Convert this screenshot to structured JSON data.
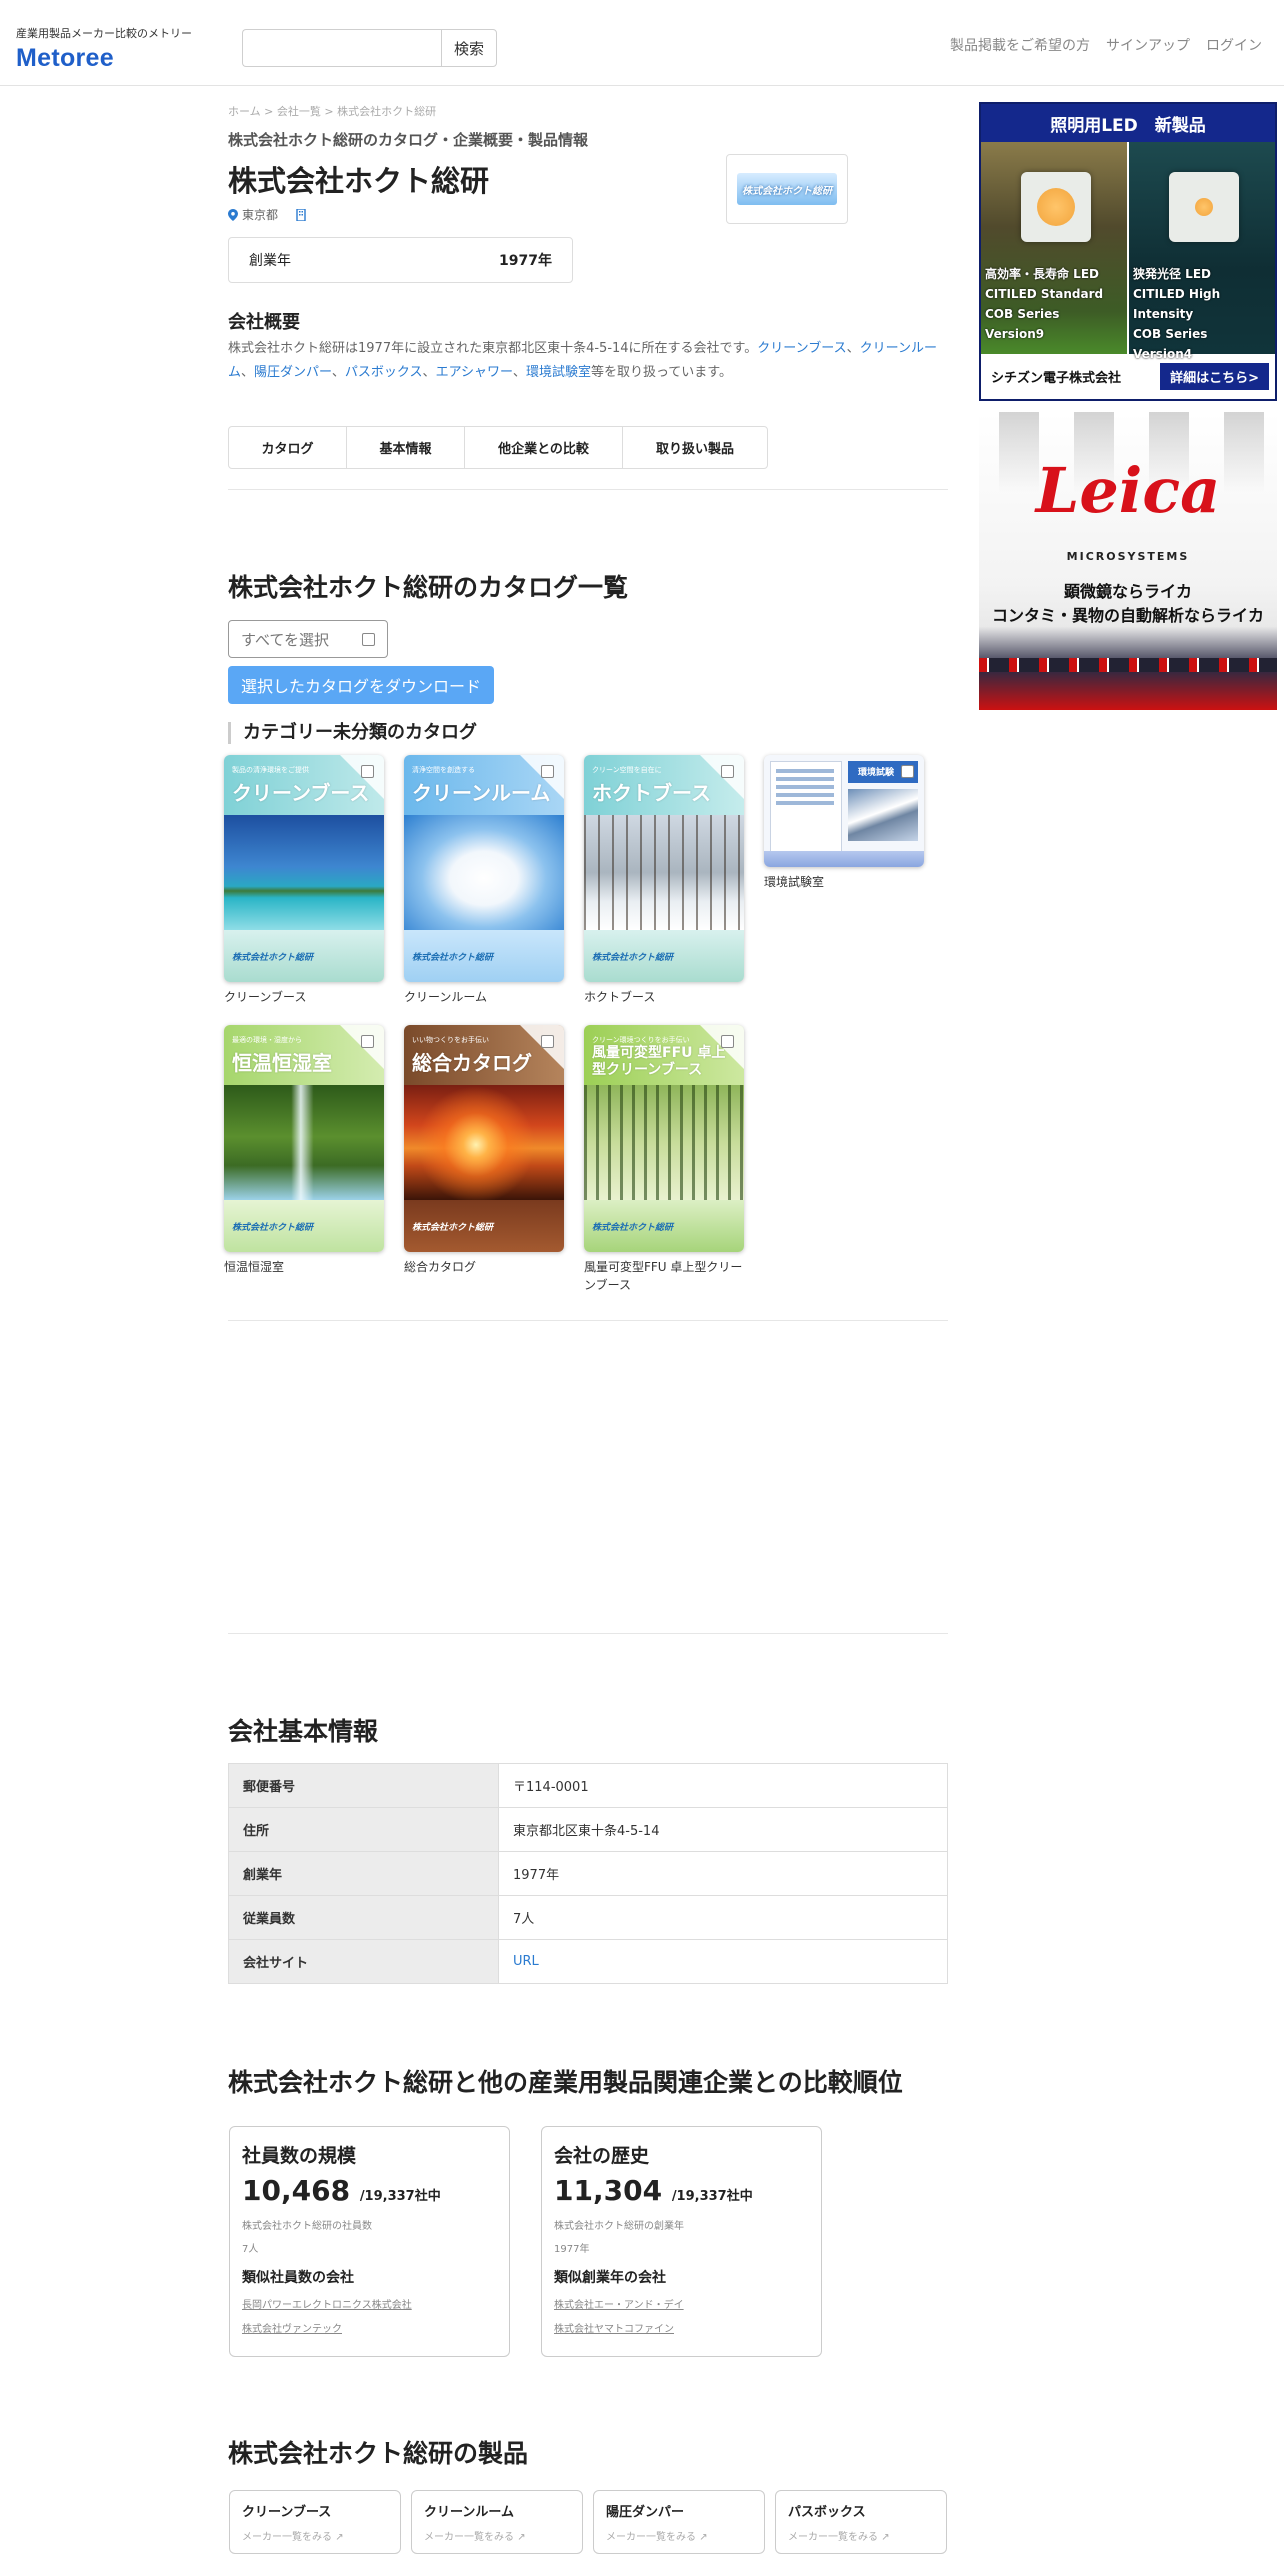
{
  "header": {
    "tagline": "産業用製品メーカー比較のメトリー",
    "logo": "Metoree",
    "search_placeholder": "",
    "search_button": "検索",
    "nav": [
      "製品掲載をご希望の方",
      "サインアップ",
      "ログイン"
    ]
  },
  "breadcrumb": [
    "ホーム",
    "会社一覧",
    "株式会社ホクト総研"
  ],
  "page": {
    "subtitle": "株式会社ホクト総研のカタログ・企業概要・製品情報",
    "company_name": "株式会社ホクト総研",
    "location": "東京都",
    "logo_text": "株式会社ホクト総研",
    "founded_label": "創業年",
    "founded_value": "1977年"
  },
  "overview": {
    "heading": "会社概要",
    "text_prefix": "株式会社ホクト総研は1977年に設立された東京都北区東十条4-5-14に所在する会社です。",
    "links": [
      "クリーンブース",
      "クリーンルーム",
      "陽圧ダンパー",
      "パスボックス",
      "エアシャワー",
      "環境試験室"
    ],
    "text_suffix": "等を取り扱っています。"
  },
  "tabs": [
    "カタログ",
    "基本情報",
    "他企業との比較",
    "取り扱い製品"
  ],
  "catalog": {
    "heading": "株式会社ホクト総研のカタログ一覧",
    "select_all": "すべてを選択",
    "download_button": "選択したカタログをダウンロード",
    "category_heading": "カテゴリー未分類のカタログ",
    "items": [
      {
        "label": "クリーンブース",
        "cover_title": "クリーンブース",
        "cover_small": "製品の清浄環境をご提供"
      },
      {
        "label": "クリーンルーム",
        "cover_title": "クリーンルーム",
        "cover_small": "清浄空間を創造する"
      },
      {
        "label": "ホクトブース",
        "cover_title": "ホクトブース",
        "cover_small": "クリーン空間を自在に"
      },
      {
        "label": "環境試験室",
        "cover_title": "環境試験",
        "cover_small": ""
      },
      {
        "label": "恒温恒湿室",
        "cover_title": "恒温恒湿室",
        "cover_small": "最適の環境・湿度から"
      },
      {
        "label": "総合カタログ",
        "cover_title": "総合カタログ",
        "cover_small": "いい物つくりをお手伝い"
      },
      {
        "label": "風量可変型FFU 卓上型クリーンブース",
        "cover_title": "風量可変型FFU 卓上型クリーンブース",
        "cover_small": "クリーン環境つくりをお手伝い"
      }
    ],
    "cover_footer": "株式会社ホクト総研"
  },
  "basic_info": {
    "heading": "会社基本情報",
    "rows": [
      {
        "key": "郵便番号",
        "value": "〒114-0001"
      },
      {
        "key": "住所",
        "value": "東京都北区東十条4-5-14"
      },
      {
        "key": "創業年",
        "value": "1977年"
      },
      {
        "key": "従業員数",
        "value": "7人"
      },
      {
        "key": "会社サイト",
        "value": "URL"
      }
    ]
  },
  "ranking": {
    "heading": "株式会社ホクト総研と他の産業用製品関連企業との比較順位",
    "cards": [
      {
        "title": "社員数の規模",
        "rank": "10,468",
        "total": "/19,337社中",
        "caption": "株式会社ホクト総研の社員数",
        "value": "7人",
        "similar_heading": "類似社員数の会社",
        "similar": [
          "長岡パワーエレクトロニクス株式会社",
          "株式会社ヴァンテック"
        ]
      },
      {
        "title": "会社の歴史",
        "rank": "11,304",
        "total": "/19,337社中",
        "caption": "株式会社ホクト総研の創業年",
        "value": "1977年",
        "similar_heading": "類似創業年の会社",
        "similar": [
          "株式会社エー・アンド・デイ",
          "株式会社ヤマトコファイン"
        ]
      }
    ]
  },
  "products": {
    "heading": "株式会社ホクト総研の製品",
    "link_label": "メーカー一覧をみる",
    "items": [
      "クリーンブース",
      "クリーンルーム",
      "陽圧ダンパー",
      "パスボックス"
    ]
  },
  "ads": {
    "ad1": {
      "top": "照明用LED　新製品",
      "left_caption": "高効率・長寿命 LED",
      "left_lines": [
        "CITILED Standard",
        "COB Series",
        "Version9"
      ],
      "right_caption": "狭発光径 LED",
      "right_lines": [
        "CITILED High Intensity",
        "COB Series",
        "Version4"
      ],
      "company": "シチズン電子株式会社",
      "more": "詳細はこちら>"
    },
    "ad2": {
      "brand": "Leica",
      "sub": "MICROSYSTEMS",
      "line1": "顕微鏡ならライカ",
      "line2": "コンタミ・異物の自動解析ならライカ"
    }
  }
}
